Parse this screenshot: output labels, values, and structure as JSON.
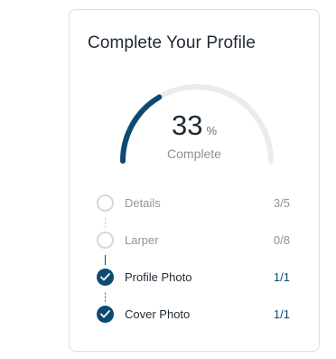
{
  "card": {
    "title": "Complete Your Profile"
  },
  "progress": {
    "value": "33",
    "percent": 33,
    "unit": "%",
    "label": "Complete",
    "colors": {
      "filled": "#0d4a73",
      "track": "#e9ebee"
    }
  },
  "steps": [
    {
      "name": "Details",
      "count": "3/5",
      "status": "pending",
      "icon": "empty-circle-icon"
    },
    {
      "name": "Larper",
      "count": "0/8",
      "status": "pending",
      "icon": "empty-circle-icon"
    },
    {
      "name": "Profile Photo",
      "count": "1/1",
      "status": "done",
      "icon": "check-circle-icon"
    },
    {
      "name": "Cover Photo",
      "count": "1/1",
      "status": "done",
      "icon": "check-circle-icon"
    }
  ]
}
